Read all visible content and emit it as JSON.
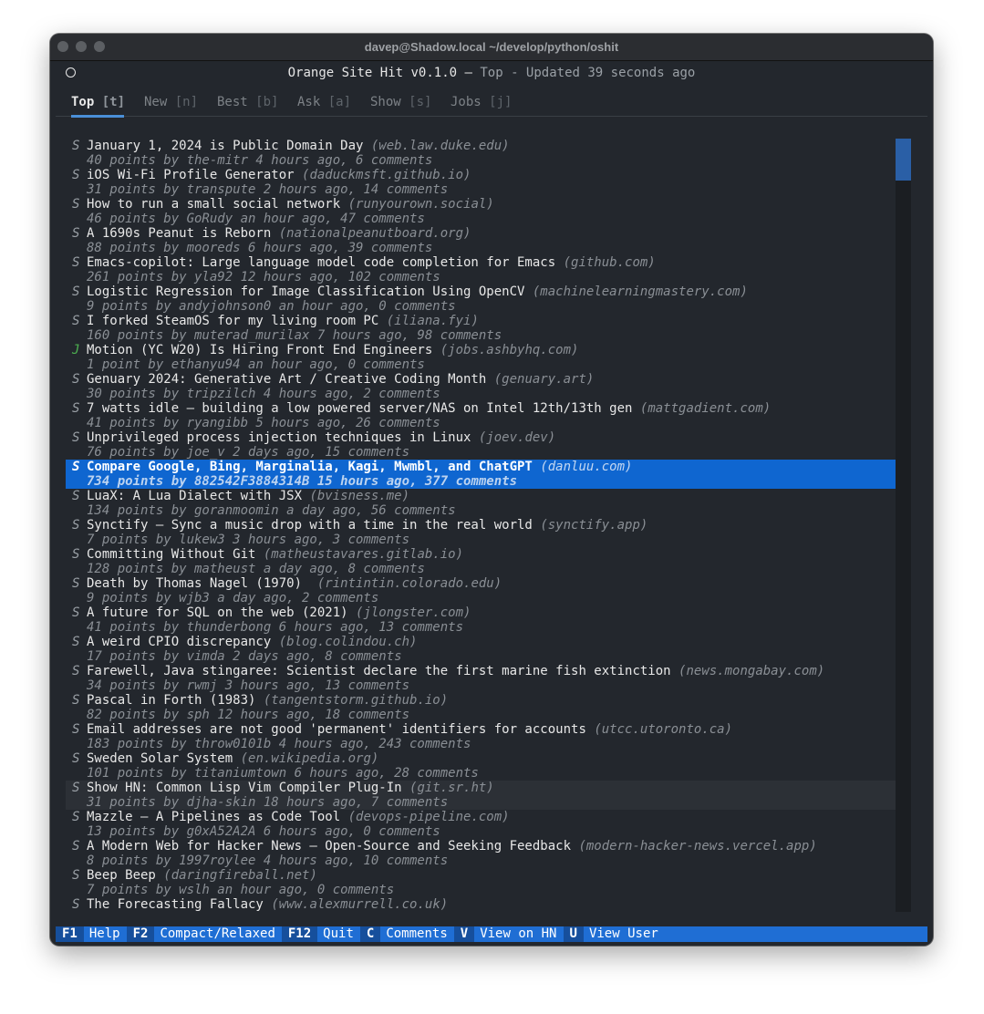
{
  "window": {
    "title": "davep@Shadow.local ~/develop/python/oshit"
  },
  "header": {
    "app_title": "Orange Site Hit v0.1.0",
    "separator": " — ",
    "status": "Top - Updated 39 seconds ago"
  },
  "tabs": [
    {
      "label": "Top",
      "key": "[t]",
      "active": true
    },
    {
      "label": "New",
      "key": "[n]"
    },
    {
      "label": "Best",
      "key": "[b]"
    },
    {
      "label": "Ask",
      "key": "[a]"
    },
    {
      "label": "Show",
      "key": "[s]"
    },
    {
      "label": "Jobs",
      "key": "[j]"
    }
  ],
  "stories": [
    {
      "kind": "S",
      "title": "January 1, 2024 is Public Domain Day",
      "domain": "(web.law.duke.edu)",
      "meta": "40 points by the-mitr 4 hours ago, 6 comments"
    },
    {
      "kind": "S",
      "title": "iOS Wi-Fi Profile Generator",
      "domain": "(daduckmsft.github.io)",
      "meta": "31 points by transpute 2 hours ago, 14 comments"
    },
    {
      "kind": "S",
      "title": "How to run a small social network",
      "domain": "(runyourown.social)",
      "meta": "46 points by GoRudy an hour ago, 47 comments"
    },
    {
      "kind": "S",
      "title": "A 1690s Peanut is Reborn",
      "domain": "(nationalpeanutboard.org)",
      "meta": "88 points by mooreds 6 hours ago, 39 comments"
    },
    {
      "kind": "S",
      "title": "Emacs-copilot: Large language model code completion for Emacs",
      "domain": "(github.com)",
      "meta": "261 points by yla92 12 hours ago, 102 comments"
    },
    {
      "kind": "S",
      "title": "Logistic Regression for Image Classification Using OpenCV",
      "domain": "(machinelearningmastery.com)",
      "meta": "9 points by andyjohnson0 an hour ago, 0 comments"
    },
    {
      "kind": "S",
      "title": "I forked SteamOS for my living room PC",
      "domain": "(iliana.fyi)",
      "meta": "160 points by muterad_murilax 7 hours ago, 98 comments"
    },
    {
      "kind": "J",
      "title": "Motion (YC W20) Is Hiring Front End Engineers",
      "domain": "(jobs.ashbyhq.com)",
      "meta": "1 point by ethanyu94 an hour ago, 0 comments"
    },
    {
      "kind": "S",
      "title": "Genuary 2024: Generative Art / Creative Coding Month",
      "domain": "(genuary.art)",
      "meta": "30 points by tripzilch 4 hours ago, 2 comments"
    },
    {
      "kind": "S",
      "title": "7 watts idle – building a low powered server/NAS on Intel 12th/13th gen",
      "domain": "(mattgadient.com)",
      "meta": "41 points by ryangibb 5 hours ago, 26 comments"
    },
    {
      "kind": "S",
      "title": "Unprivileged process injection techniques in Linux",
      "domain": "(joev.dev)",
      "meta": "76 points by joe_v 2 days ago, 15 comments"
    },
    {
      "kind": "S",
      "title": "Compare Google, Bing, Marginalia, Kagi, Mwmbl, and ChatGPT",
      "domain": "(danluu.com)",
      "meta": "734 points by 882542F3884314B 15 hours ago, 377 comments",
      "selected": true
    },
    {
      "kind": "S",
      "title": "LuaX: A Lua Dialect with JSX",
      "domain": "(bvisness.me)",
      "meta": "134 points by goranmoomin a day ago, 56 comments"
    },
    {
      "kind": "S",
      "title": "Synctify – Sync a music drop with a time in the real world",
      "domain": "(synctify.app)",
      "meta": "7 points by lukew3 3 hours ago, 3 comments"
    },
    {
      "kind": "S",
      "title": "Committing Without Git",
      "domain": "(matheustavares.gitlab.io)",
      "meta": "128 points by matheust a day ago, 8 comments"
    },
    {
      "kind": "S",
      "title": "Death by Thomas Nagel (1970) ",
      "domain": "(rintintin.colorado.edu)",
      "meta": "9 points by wjb3 a day ago, 2 comments"
    },
    {
      "kind": "S",
      "title": "A future for SQL on the web (2021)",
      "domain": "(jlongster.com)",
      "meta": "41 points by thunderbong 6 hours ago, 13 comments"
    },
    {
      "kind": "S",
      "title": "A weird CPIO discrepancy",
      "domain": "(blog.colindou.ch)",
      "meta": "17 points by vimda 2 days ago, 8 comments"
    },
    {
      "kind": "S",
      "title": "Farewell, Java stingaree: Scientist declare the first marine fish extinction",
      "domain": "(news.mongabay.com)",
      "meta": "34 points by rwmj 3 hours ago, 13 comments"
    },
    {
      "kind": "S",
      "title": "Pascal in Forth (1983)",
      "domain": "(tangentstorm.github.io)",
      "meta": "82 points by sph 12 hours ago, 18 comments"
    },
    {
      "kind": "S",
      "title": "Email addresses are not good 'permanent' identifiers for accounts",
      "domain": "(utcc.utoronto.ca)",
      "meta": "183 points by throw0101b 4 hours ago, 243 comments"
    },
    {
      "kind": "S",
      "title": "Sweden Solar System",
      "domain": "(en.wikipedia.org)",
      "meta": "101 points by titaniumtown 6 hours ago, 28 comments"
    },
    {
      "kind": "S",
      "title": "Show HN: Common Lisp Vim Compiler Plug-In",
      "domain": "(git.sr.ht)",
      "meta": "31 points by djha-skin 18 hours ago, 7 comments",
      "hover": true
    },
    {
      "kind": "S",
      "title": "Mazzle – A Pipelines as Code Tool",
      "domain": "(devops-pipeline.com)",
      "meta": "13 points by g0xA52A2A 6 hours ago, 0 comments"
    },
    {
      "kind": "S",
      "title": "A Modern Web for Hacker News – Open-Source and Seeking Feedback",
      "domain": "(modern-hacker-news.vercel.app)",
      "meta": "8 points by 1997roylee 4 hours ago, 10 comments"
    },
    {
      "kind": "S",
      "title": "Beep Beep",
      "domain": "(daringfireball.net)",
      "meta": "7 points by wslh an hour ago, 0 comments"
    },
    {
      "kind": "S",
      "title": "The Forecasting Fallacy",
      "domain": "(www.alexmurrell.co.uk)",
      "meta": ""
    }
  ],
  "footer": [
    {
      "key": "F1",
      "label": "Help"
    },
    {
      "key": "F2",
      "label": "Compact/Relaxed"
    },
    {
      "key": "F12",
      "label": "Quit"
    },
    {
      "key": "C",
      "label": "Comments"
    },
    {
      "key": "V",
      "label": "View on HN"
    },
    {
      "key": "U",
      "label": "View User"
    }
  ]
}
